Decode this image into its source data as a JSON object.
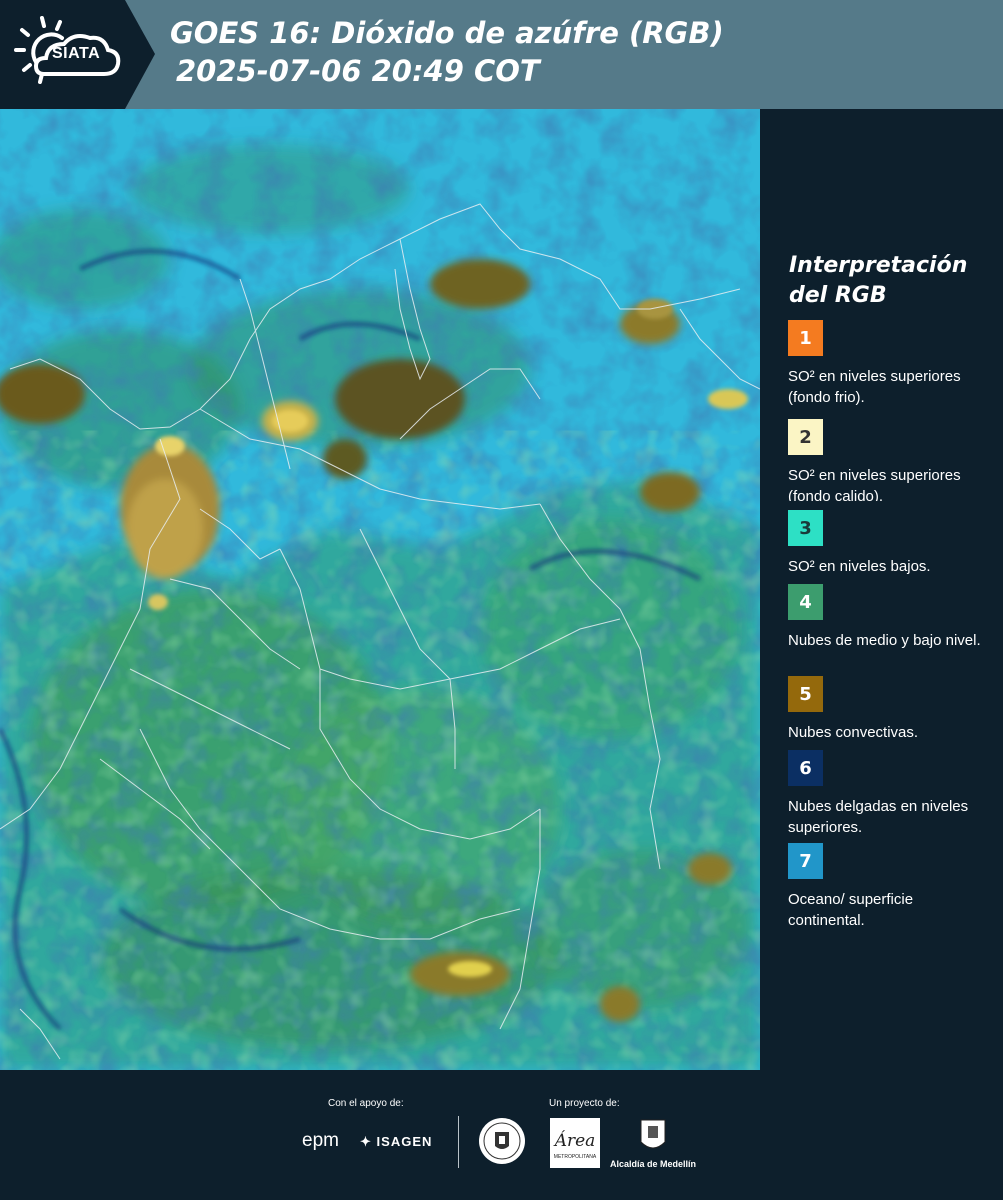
{
  "header": {
    "logo_label": "SIATA",
    "title_line1": "GOES 16: Dióxido de azúfre (RGB)",
    "title_line2": "2025-07-06 20:49 COT"
  },
  "legend": {
    "title": "Interpretación del RGB",
    "items": [
      {
        "number": "1",
        "label": "SO² en niveles superiores (fondo frio).",
        "color": "#f47b20",
        "text_color": "#ffffff"
      },
      {
        "number": "2",
        "label": "SO² en niveles superiores (fondo calido).",
        "color": "#fbf5c5",
        "text_color": "#333333"
      },
      {
        "number": "3",
        "label": "SO² en niveles bajos.",
        "color": "#2de0c5",
        "text_color": "#1a3a3a"
      },
      {
        "number": "4",
        "label": "Nubes de medio y bajo nivel.",
        "color": "#3c9d6e",
        "text_color": "#ffffff"
      },
      {
        "number": "5",
        "label": "Nubes convectivas.",
        "color": "#94690c",
        "text_color": "#ffffff"
      },
      {
        "number": "6",
        "label": "Nubes delgadas en niveles superiores.",
        "color": "#0b2f63",
        "text_color": "#ffffff"
      },
      {
        "number": "7",
        "label": "Oceano/ superficie continental.",
        "color": "#2196c9",
        "text_color": "#ffffff"
      }
    ]
  },
  "footer": {
    "support_label": "Con el apoyo de:",
    "project_label": "Un proyecto de:",
    "epm": "epm",
    "isagen": "ISAGEN",
    "area": "Área",
    "area_sub": "METROPOLITANA",
    "alcaldia": "Alcaldía de Medellín"
  },
  "colors": {
    "background": "#0d1f2c",
    "header_bar": "#557a89",
    "ocean": "#2ab4d8"
  }
}
